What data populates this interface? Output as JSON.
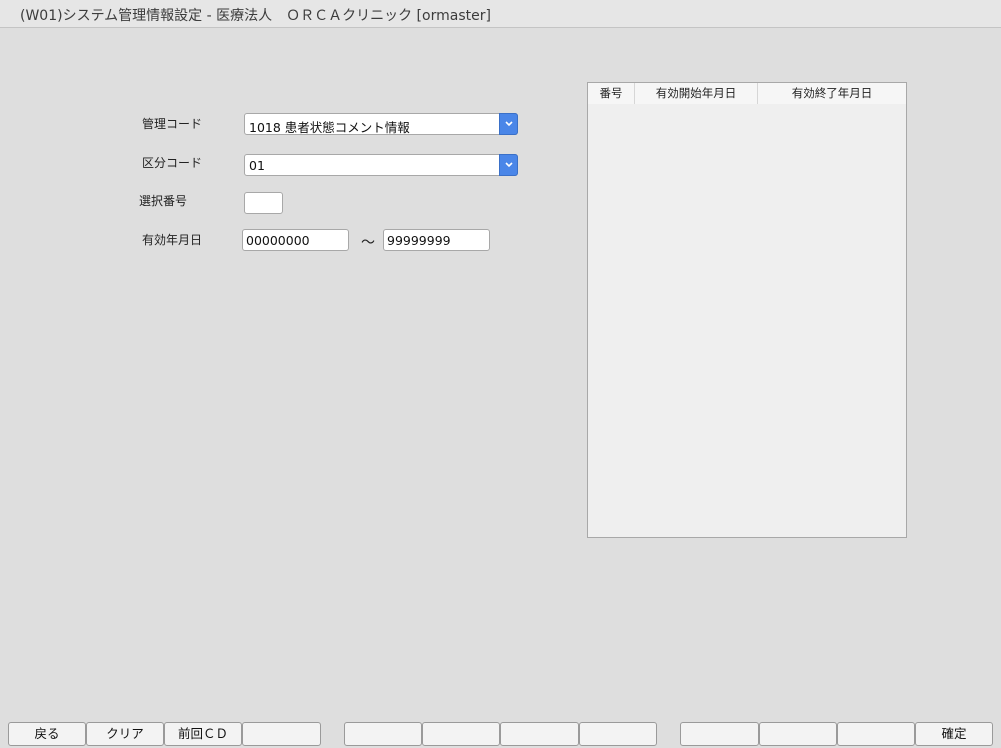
{
  "window": {
    "title": "(W01)システム管理情報設定 - 医療法人　ＯＲＣＡクリニック [ormaster]"
  },
  "form": {
    "kanri_code": {
      "label": "管理コード",
      "value": "1018 患者状態コメント情報"
    },
    "kubun_code": {
      "label": "区分コード",
      "value": "01"
    },
    "sentaku_bango": {
      "label": "選択番号",
      "value": ""
    },
    "yuko_date": {
      "label": "有効年月日",
      "from": "00000000",
      "separator": "～",
      "to": "99999999"
    }
  },
  "list": {
    "columns": [
      "番号",
      "有効開始年月日",
      "有効終了年月日"
    ],
    "rows": []
  },
  "footer": {
    "buttons": [
      "戻る",
      "クリア",
      "前回ＣＤ",
      "",
      "",
      "",
      "",
      "",
      "",
      "",
      "",
      "確定"
    ]
  },
  "colors": {
    "background": "#dedede",
    "dropdown_accent": "#4a86e8"
  }
}
